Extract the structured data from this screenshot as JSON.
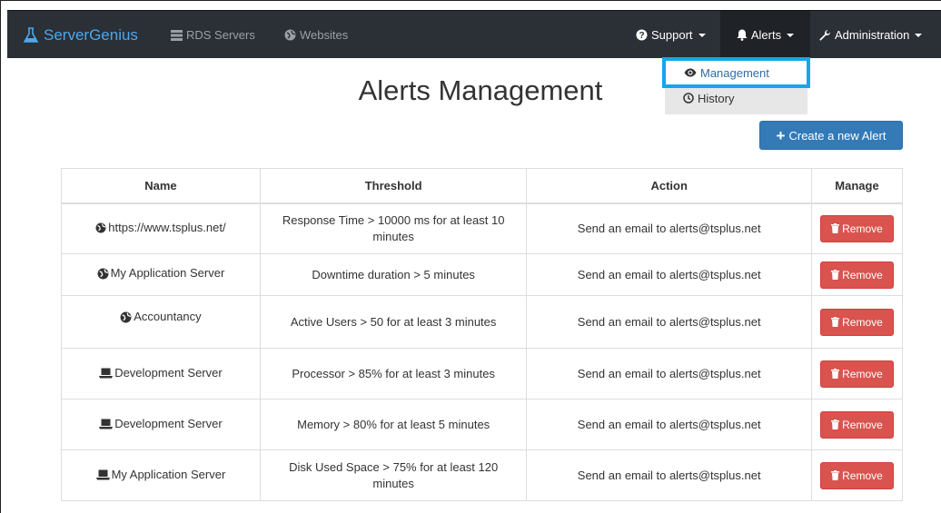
{
  "navbar": {
    "brand": "ServerGenius",
    "rds_servers": "RDS Servers",
    "websites": "Websites",
    "support": "Support",
    "alerts": "Alerts",
    "administration": "Administration"
  },
  "dropdown": {
    "management": "Management",
    "history": "History"
  },
  "page": {
    "title": "Alerts Management",
    "create_button": "Create a new Alert"
  },
  "table": {
    "headers": [
      "Name",
      "Threshold",
      "Action",
      "Manage"
    ],
    "rows": [
      {
        "icon": "globe-icon",
        "name": " https://www.tsplus.net/",
        "threshold": "Response Time > 10000 ms for at least 10 minutes",
        "action": "Send an email to alerts@tsplus.net",
        "manage": "Remove"
      },
      {
        "icon": "globe-icon",
        "name": "My Application Server",
        "threshold": "Downtime duration > 5 minutes",
        "action": "Send an email to alerts@tsplus.net",
        "manage": "Remove"
      },
      {
        "icon": "globe-icon",
        "name": "Accountancy",
        "threshold": "Active Users > 50 for at least 3 minutes",
        "action": "Send an email to alerts@tsplus.net",
        "manage": "Remove"
      },
      {
        "icon": "laptop-icon",
        "name": "Development Server",
        "threshold": "Processor > 85% for at least 3 minutes",
        "action": "Send an email to alerts@tsplus.net",
        "manage": "Remove"
      },
      {
        "icon": "laptop-icon",
        "name": "Development Server",
        "threshold": "Memory > 80% for at least 5 minutes",
        "action": "Send an email to alerts@tsplus.net",
        "manage": "Remove"
      },
      {
        "icon": "laptop-icon",
        "name": "My Application Server",
        "threshold": "Disk Used Space > 75% for at least 120 minutes",
        "action": "Send an email to alerts@tsplus.net",
        "manage": "Remove"
      }
    ]
  },
  "colors": {
    "navbar_bg": "#2b2f36",
    "brand": "#4aa8ee",
    "primary": "#337ab7",
    "danger": "#d9534f",
    "highlight": "#17a6e8"
  }
}
